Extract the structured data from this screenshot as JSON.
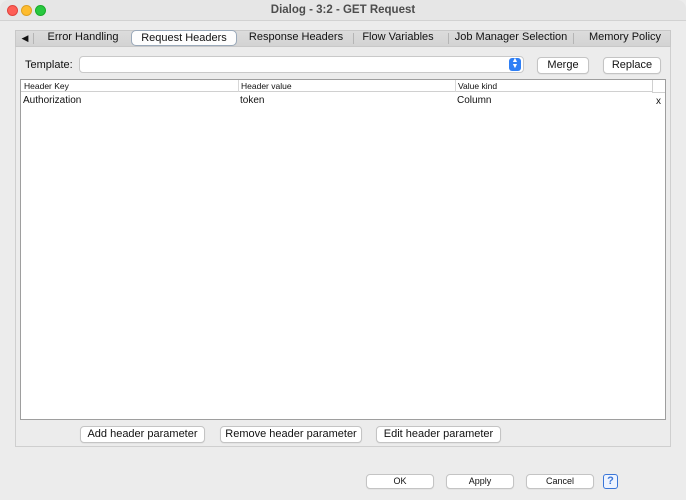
{
  "window": {
    "title": "Dialog - 3:2 - GET Request"
  },
  "tabs": {
    "scroll_icon": "◀",
    "items": [
      {
        "label": "Error Handling",
        "active": false
      },
      {
        "label": "Request Headers",
        "active": true
      },
      {
        "label": "Response Headers",
        "active": false
      },
      {
        "label": "Flow Variables",
        "active": false
      },
      {
        "label": "Job Manager Selection",
        "active": false
      },
      {
        "label": "Memory Policy",
        "active": false
      }
    ]
  },
  "template": {
    "label": "Template:",
    "value": "",
    "merge_label": "Merge",
    "replace_label": "Replace"
  },
  "table": {
    "columns": [
      "Header Key",
      "Header value",
      "Value kind"
    ],
    "rows": [
      {
        "key": "Authorization",
        "value": "token",
        "kind": "Column",
        "remove": "x"
      }
    ]
  },
  "actions": {
    "add_label": "Add header parameter",
    "remove_label": "Remove header parameter",
    "edit_label": "Edit header parameter"
  },
  "footer": {
    "ok_label": "OK",
    "apply_label": "Apply",
    "cancel_label": "Cancel",
    "help_label": "?"
  },
  "colors": {
    "accent": "#2f7ff5",
    "close": "#fe5f57",
    "minimize": "#febc2e",
    "maximize": "#28c840"
  }
}
